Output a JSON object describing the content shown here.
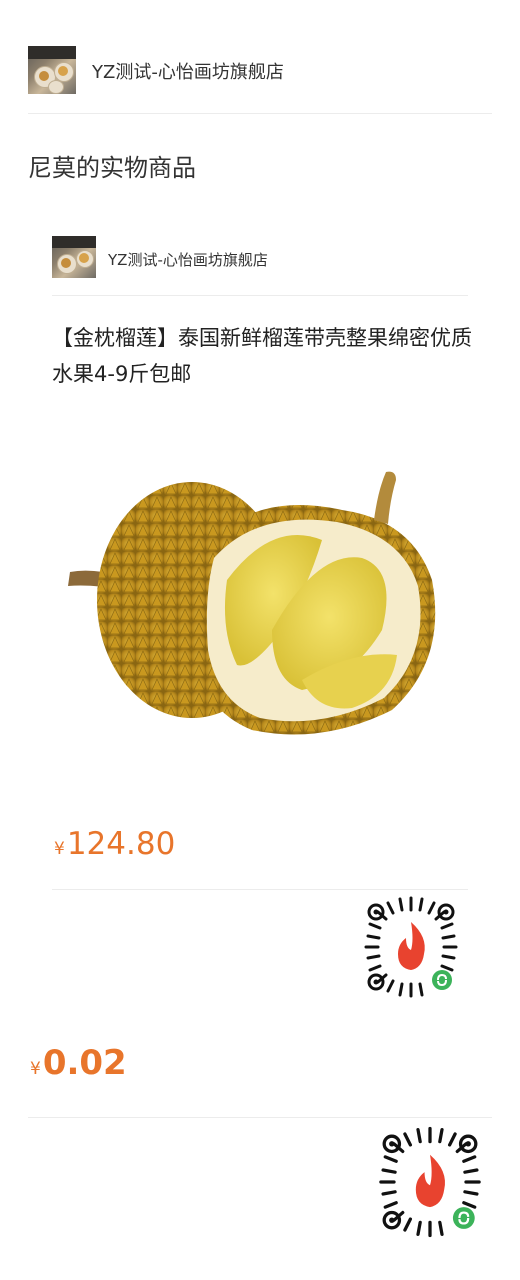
{
  "header": {
    "shop_name": "YZ测试-心怡画坊旗舰店"
  },
  "section": {
    "title": "尼莫的实物商品"
  },
  "product_card": {
    "shop_name": "YZ测试-心怡画坊旗舰店",
    "product_title": "【金枕榴莲】泰国新鲜榴莲带壳整果绵密优质水果4-9斤包邮",
    "image_icon": "durian-photo",
    "price_symbol": "¥",
    "price": "124.80",
    "qr_icon": "mini-program-code-icon"
  },
  "second_price": {
    "price_symbol": "¥",
    "price": "0.02",
    "qr_icon": "mini-program-code-icon"
  },
  "colors": {
    "price": "#e8752b",
    "qr_flame": "#e8432f",
    "qr_badge": "#3cb35a",
    "divider": "#ececec"
  }
}
